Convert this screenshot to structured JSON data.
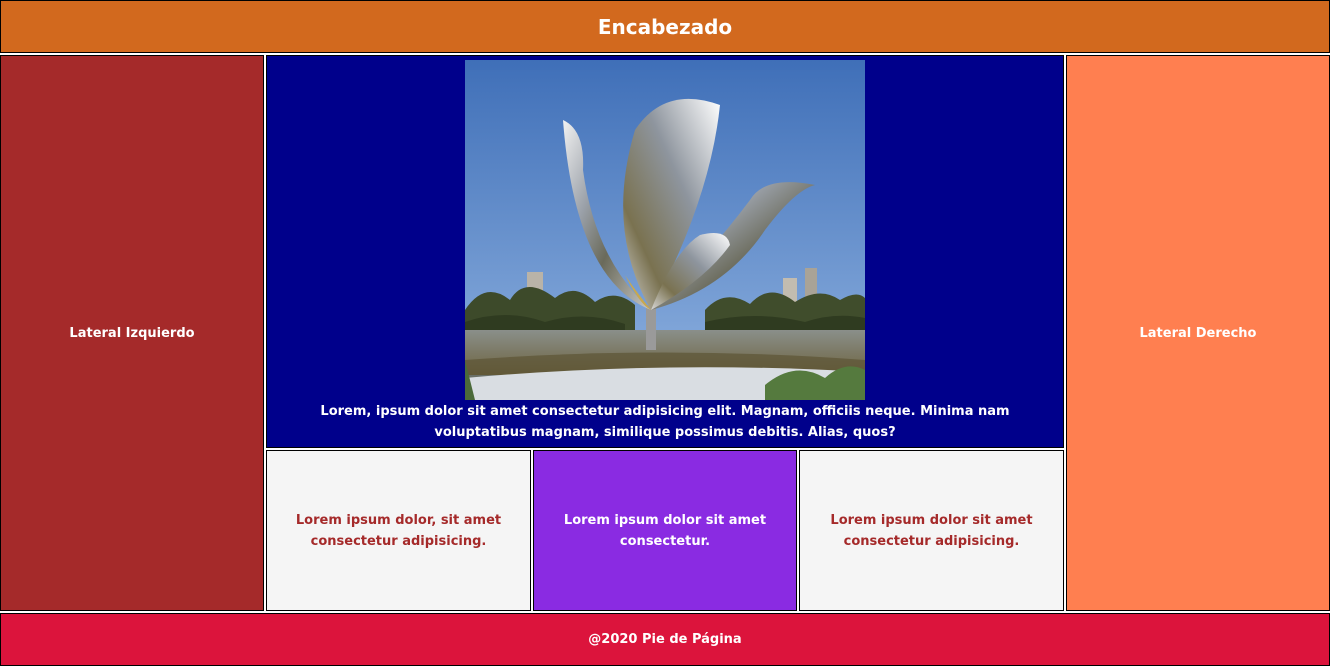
{
  "header": {
    "title": "Encabezado",
    "color": "#d2691e"
  },
  "sidebar_left": {
    "label": "Lateral Izquierdo",
    "color": "#a52a2a"
  },
  "sidebar_right": {
    "label": "Lateral Derecho",
    "color": "#ff7f50"
  },
  "main": {
    "image_subject": "flower-sculpture-photo",
    "text": "Lorem, ipsum dolor sit amet consectetur adipisicing elit. Magnam, officiis neque. Minima nam voluptatibus magnam, similique possimus debitis. Alias, quos?",
    "color": "#00008b"
  },
  "cards": [
    {
      "text": "Lorem ipsum dolor, sit amet consectetur adipisicing.",
      "color": "#f5f5f5"
    },
    {
      "text": "Lorem ipsum dolor sit amet consectetur.",
      "color": "#8a2be2"
    },
    {
      "text": "Lorem ipsum dolor sit amet consectetur adipisicing.",
      "color": "#f5f5f5"
    }
  ],
  "footer": {
    "text": "@2020 Pie de Página",
    "color": "#dc143c"
  }
}
